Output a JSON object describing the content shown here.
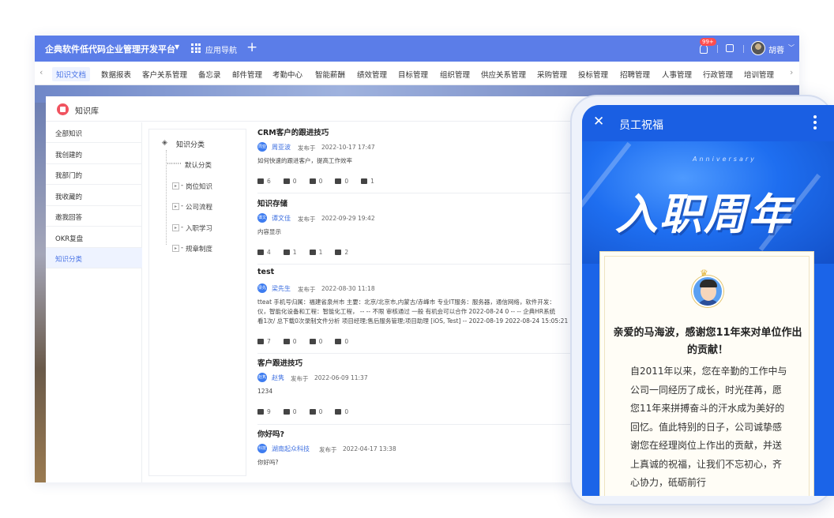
{
  "topbar": {
    "brand": "企典软件低代码企业管理开发平台",
    "app_nav": "应用导航",
    "badge": "99+",
    "user_name": "胡蓉"
  },
  "modules": [
    "知识文档",
    "数据报表",
    "客户关系管理",
    "备忘录",
    "邮件管理",
    "考勤中心",
    "智能薪酬",
    "绩效管理",
    "目标管理",
    "组织管理",
    "供应关系管理",
    "采购管理",
    "投标管理",
    "招聘管理",
    "人事管理",
    "行政管理",
    "培训管理"
  ],
  "panel": {
    "title": "知识库",
    "side_items": [
      "全部知识",
      "我创建的",
      "我部门的",
      "我收藏的",
      "邀我回答",
      "OKR复盘",
      "知识分类"
    ],
    "tree": {
      "root": "知识分类",
      "children": [
        "默认分类",
        "岗位知识",
        "公司流程",
        "入职学习",
        "规章制度"
      ]
    }
  },
  "articles": [
    {
      "title": "CRM客户的跟进技巧",
      "avatar": "周亚",
      "author": "周亚波",
      "published": "发布于",
      "date": "2022-10-17 17:47",
      "body": [
        "如何快速的跟进客户，提高工作效率"
      ],
      "stats": [
        "6",
        "0",
        "0",
        "0",
        "1"
      ]
    },
    {
      "title": "知识存储",
      "avatar": "谭文",
      "author": "谭文佳",
      "published": "发布于",
      "date": "2022-09-29 19:42",
      "body": [
        "内容显示"
      ],
      "stats": [
        "4",
        "1",
        "1",
        "2"
      ]
    },
    {
      "title": "test",
      "avatar": "梁先",
      "author": "梁先生",
      "published": "发布于",
      "date": "2022-08-30 11:18",
      "body": [
        "tteat 手机号归属：福建省泉州市 主要：北京/北京市,内蒙古/赤峰市 专业IT服务：服务器，通信网络，软件开发：",
        "仪，智能化设备和工程：智能化工程， -- -- 不限 审核通过 一般 有机会可以合作 2022-08-24 0 -- -- 企典HR系统",
        "看1次/ 总下载0次录制文件分析 项目经理;售后服务管理;项目助理 [iOS, Test] -- 2022-08-19 2022-08-24 15:05:21"
      ],
      "stats": [
        "7",
        "0",
        "0",
        "0"
      ]
    },
    {
      "title": "客户跟进技巧",
      "avatar": "赵隽",
      "author": "赵隽",
      "published": "发布于",
      "date": "2022-06-09 11:37",
      "body": [
        "1234"
      ],
      "stats": [
        "9",
        "0",
        "0",
        "0"
      ]
    },
    {
      "title": "你好吗?",
      "avatar": "科技",
      "author": "湖南起众科技",
      "published": "发布于",
      "date": "2022-04-17 13:38",
      "body": [
        "你好吗?"
      ],
      "stats": []
    }
  ],
  "phone": {
    "title": "员工祝福",
    "anniversary": "Anniversary",
    "calligraphy": "入职周年",
    "greeting": "亲爱的马海波，感谢您11年来对单位作出的贡献！",
    "message": "自2011年以来，您在辛勤的工作中与公司一同经历了成长，时光荏苒，愿您11年来拼搏奋斗的汗水成为美好的回忆。值此特别的日子，公司诚挚感谢您在经理岗位上作出的贡献，并送上真诚的祝福，让我们不忘初心，齐心协力，砥砺前行"
  },
  "colors": {
    "primary": "#5b7de8",
    "link": "#3d6fe0",
    "phone_blue": "#1a5fe3",
    "badge": "#ff4d4f"
  }
}
